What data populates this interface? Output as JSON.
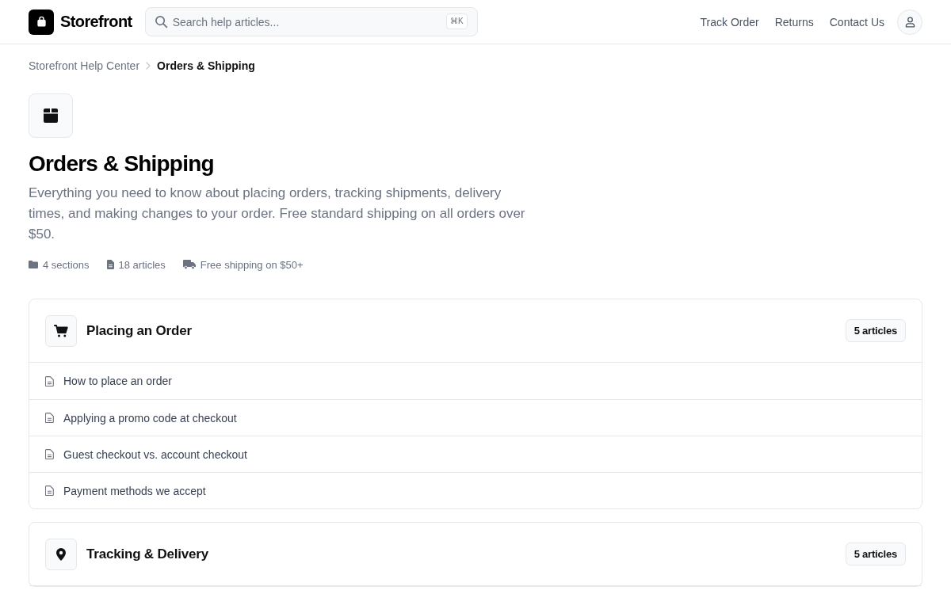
{
  "header": {
    "logo": {
      "name": "Storefront"
    },
    "search": {
      "placeholder": "Search help articles...",
      "shortcut": "⌘K"
    },
    "nav": [
      {
        "label": "Track Order"
      },
      {
        "label": "Returns"
      },
      {
        "label": "Contact Us"
      }
    ]
  },
  "breadcrumb": [
    {
      "label": "Storefront Help Center",
      "current": false
    },
    {
      "label": "Orders & Shipping",
      "current": true
    }
  ],
  "category": {
    "title": "Orders & Shipping",
    "description": "Everything you need to know about placing orders, tracking shipments, delivery times, and making changes to your order. Free standard shipping on all orders over $50.",
    "meta": [
      {
        "kind": "sections",
        "text": "4 sections"
      },
      {
        "kind": "articles",
        "text": "18 articles"
      },
      {
        "kind": "shipping",
        "text": "Free shipping on $50+"
      }
    ]
  },
  "sections": [
    {
      "kind": "order",
      "title": "Placing an Order",
      "count": "5 articles",
      "articles": [
        {
          "title": "How to place an order"
        },
        {
          "title": "Applying a promo code at checkout"
        },
        {
          "title": "Guest checkout vs. account checkout"
        },
        {
          "title": "Payment methods we accept"
        }
      ]
    },
    {
      "kind": "tracking",
      "title": "Tracking & Delivery",
      "count": "5 articles"
    }
  ]
}
